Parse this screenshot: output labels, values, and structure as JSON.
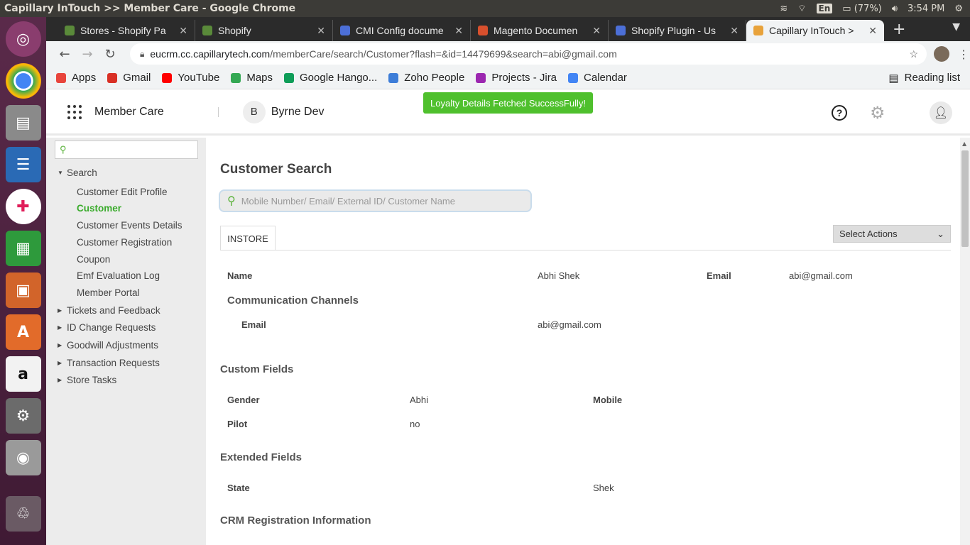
{
  "os": {
    "window_title": "Capillary InTouch >> Member Care - Google Chrome",
    "lang": "En",
    "battery": "(77%)",
    "time": "3:54 PM"
  },
  "launcher": {
    "apps": [
      "ubuntu-dash-icon",
      "chrome-icon",
      "files-icon",
      "writer-icon",
      "slack-icon",
      "calc-icon",
      "impress-icon",
      "software-center-icon",
      "amazon-icon",
      "system-settings-icon",
      "camera-icon",
      "trash-icon"
    ]
  },
  "tabs": [
    {
      "label": "Stores - Shopify Pa",
      "color": "#5a8a3a"
    },
    {
      "label": "Shopify",
      "color": "#5a8a3a"
    },
    {
      "label": "CMI Config docume",
      "color": "#4c6fd7"
    },
    {
      "label": "Magento Documen",
      "color": "#d8502d"
    },
    {
      "label": "Shopify Plugin - Us",
      "color": "#4c6fd7"
    },
    {
      "label": "Capillary InTouch >",
      "color": "#e8a23a"
    }
  ],
  "address": {
    "host": "eucrm.cc.capillarytech.com",
    "path": "/memberCare/search/Customer?flash=&id=14479699&search=abi@gmail.com"
  },
  "bookmarks": [
    {
      "label": "Apps",
      "color": "#e8453c"
    },
    {
      "label": "Gmail",
      "color": "#d93025"
    },
    {
      "label": "YouTube",
      "color": "#ff0000"
    },
    {
      "label": "Maps",
      "color": "#34a853"
    },
    {
      "label": "Google Hango...",
      "color": "#0f9d58"
    },
    {
      "label": "Zoho People",
      "color": "#3d7dd8"
    },
    {
      "label": "Projects - Jira",
      "color": "#9c27b0"
    },
    {
      "label": "Calendar",
      "color": "#4285f4"
    }
  ],
  "reading_list": "Reading list",
  "header": {
    "app_name": "Member Care",
    "org_initial": "B",
    "org_name": "Byrne Dev"
  },
  "toast": "Loyalty Details Fetched SuccessFully!",
  "sidebar": {
    "search_group": "Search",
    "search_items": [
      "Customer Edit Profile",
      "Customer",
      "Customer Events Details",
      "Customer Registration",
      "Coupon",
      "Emf Evaluation Log",
      "Member Portal"
    ],
    "groups": [
      "Tickets and Feedback",
      "ID Change Requests",
      "Goodwill Adjustments",
      "Transaction Requests",
      "Store Tasks"
    ]
  },
  "main": {
    "title": "Customer Search",
    "search_placeholder": "Mobile Number/ Email/ External ID/ Customer Name",
    "tab": "INSTORE",
    "actions": "Select Actions",
    "name_label": "Name",
    "name_value": "Abhi Shek",
    "email_label": "Email",
    "email_value": "abi@gmail.com",
    "comm_title": "Communication Channels",
    "comm_email_label": "Email",
    "comm_email_value": "abi@gmail.com",
    "custom_title": "Custom Fields",
    "gender_label": "Gender",
    "gender_value": "Abhi",
    "mobile_label": "Mobile",
    "pilot_label": "Pilot",
    "pilot_value": "no",
    "extended_title": "Extended Fields",
    "state_label": "State",
    "state_value": "Shek",
    "crm_title": "CRM Registration Information"
  }
}
